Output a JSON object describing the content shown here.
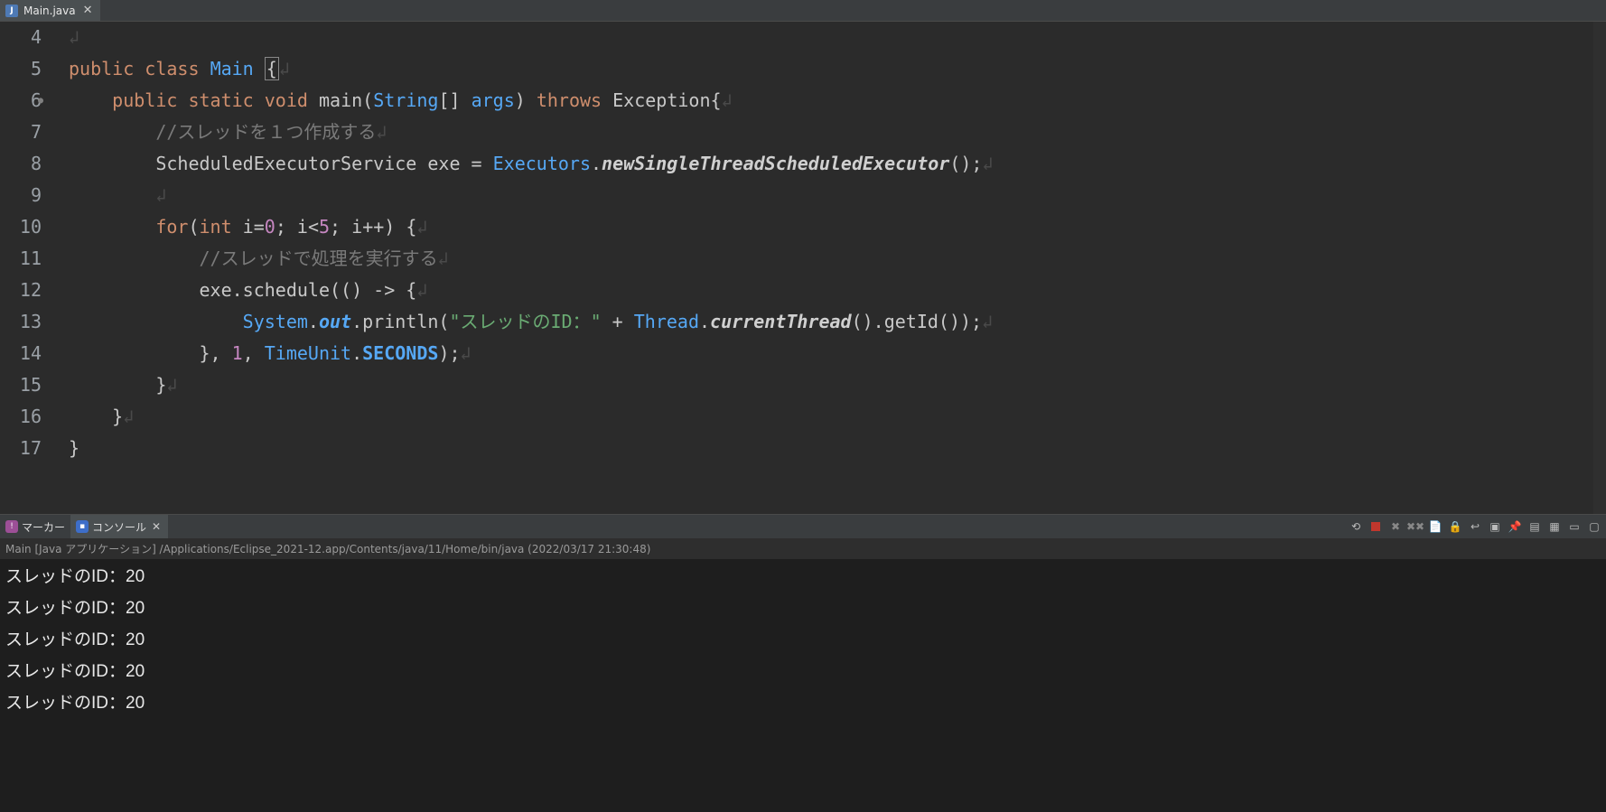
{
  "editor": {
    "tab": {
      "filename": "Main.java"
    },
    "lines": [
      {
        "num": "4",
        "html": "<span class='whitespace'>↲</span>"
      },
      {
        "num": "5",
        "html": "<span class='kw'>public</span> <span class='kw'>class</span> <span class='cls'>Main</span> <span class='caret-box'>{</span><span class='whitespace'>↲</span>"
      },
      {
        "num": "6",
        "bp": true,
        "html": "    <span class='kw'>public</span> <span class='kw'>static</span> <span class='kw'>void</span> <span class='method'>main</span>(<span class='param'>String</span>[] <span class='param'>args</span>) <span class='kw'>throws</span> <span class='type'>Exception</span>{<span class='whitespace'>↲</span>"
      },
      {
        "num": "7",
        "html": "        <span class='comment'>//スレッドを１つ作成する</span><span class='whitespace'>↲</span>"
      },
      {
        "num": "8",
        "html": "        <span class='type'>ScheduledExecutorService</span> <span class='type'>exe</span> = <span class='static-call'>Executors</span>.<span class='em'>newSingleThreadScheduledExecutor</span>();<span class='whitespace'>↲</span>"
      },
      {
        "num": "9",
        "html": "        <span class='whitespace'>↲</span>"
      },
      {
        "num": "10",
        "html": "        <span class='kw'>for</span>(<span class='kw'>int</span> <span class='type'>i</span>=<span class='num'>0</span>; <span class='type'>i</span>&lt;<span class='num'>5</span>; <span class='type'>i</span>++) {<span class='whitespace'>↲</span>"
      },
      {
        "num": "11",
        "html": "            <span class='comment'>//スレッドで処理を実行する</span><span class='whitespace'>↲</span>"
      },
      {
        "num": "12",
        "html": "            <span class='type'>exe</span>.schedule(() -&gt; {<span class='whitespace'>↲</span>"
      },
      {
        "num": "13",
        "html": "                <span class='static-call'>System</span>.<span class='field em'>out</span>.println(<span class='str'>\"スレッドのID：\"</span> + <span class='static-call'>Thread</span>.<span class='em'>currentThread</span>().getId());<span class='whitespace'>↲</span>"
      },
      {
        "num": "14",
        "html": "            }, <span class='num'>1</span>, <span class='static-call'>TimeUnit</span>.<span class='field boldm'>SECONDS</span>);<span class='whitespace'>↲</span>"
      },
      {
        "num": "15",
        "html": "        }<span class='whitespace'>↲</span>"
      },
      {
        "num": "16",
        "html": "    }<span class='whitespace'>↲</span>"
      },
      {
        "num": "17",
        "html": "}"
      }
    ]
  },
  "panel": {
    "tabs": {
      "markers": "マーカー",
      "console": "コンソール"
    },
    "header": "Main [Java アプリケーション] /Applications/Eclipse_2021-12.app/Contents/java/11/Home/bin/java  (2022/03/17 21:30:48)",
    "output": [
      "スレッドのID：20",
      "スレッドのID：20",
      "スレッドのID：20",
      "スレッドのID：20",
      "スレッドのID：20"
    ]
  }
}
